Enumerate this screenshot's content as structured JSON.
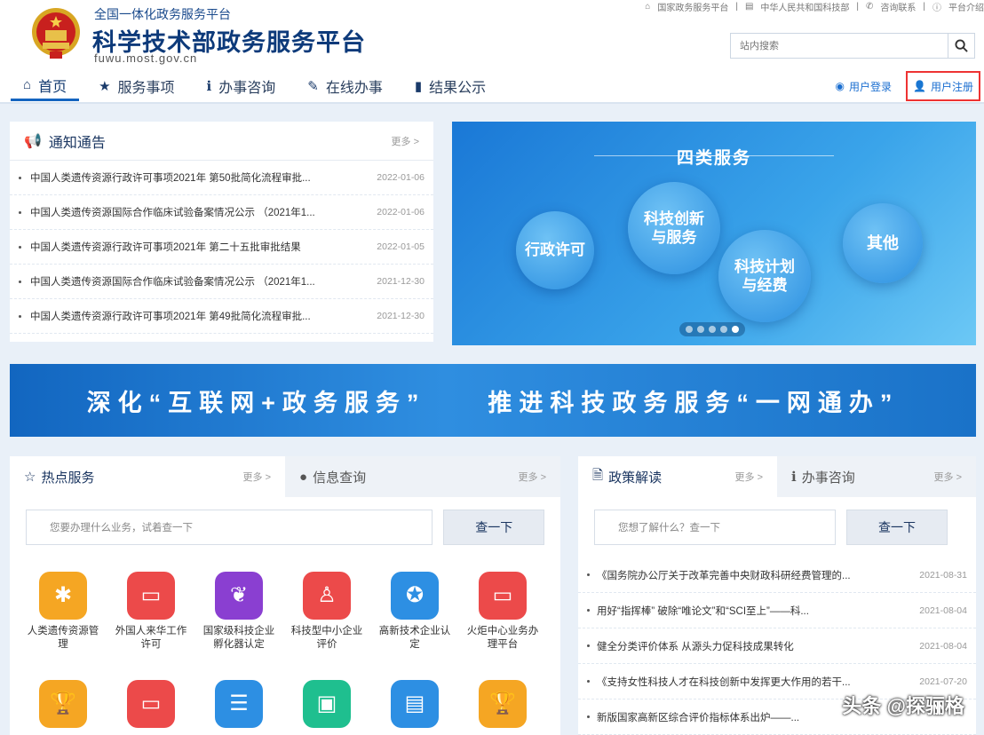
{
  "header": {
    "subtitle": "全国一体化政务服务平台",
    "title": "科学技术部政务服务平台",
    "url": "fuwu.most.gov.cn",
    "top_links": [
      "国家政务服务平台",
      "中华人民共和国科技部",
      "咨询联系",
      "平台介绍"
    ],
    "search_placeholder": "站内搜索"
  },
  "nav": {
    "items": [
      "首页",
      "服务事项",
      "办事咨询",
      "在线办事",
      "结果公示"
    ],
    "login": "用户登录",
    "register": "用户注册"
  },
  "notice": {
    "title": "通知通告",
    "more": "更多 >",
    "items": [
      {
        "text": "中国人类遗传资源行政许可事项2021年 第50批简化流程审批...",
        "date": "2022-01-06"
      },
      {
        "text": "中国人类遗传资源国际合作临床试验备案情况公示 （2021年1...",
        "date": "2022-01-06"
      },
      {
        "text": "中国人类遗传资源行政许可事项2021年 第二十五批审批结果",
        "date": "2022-01-05"
      },
      {
        "text": "中国人类遗传资源国际合作临床试验备案情况公示 （2021年1...",
        "date": "2021-12-30"
      },
      {
        "text": "中国人类遗传资源行政许可事项2021年 第49批简化流程审批...",
        "date": "2021-12-30"
      }
    ]
  },
  "banner": {
    "title": "四类服务",
    "circles": [
      "行政许可",
      "科技创新与服务",
      "科技计划与经费",
      "其他"
    ]
  },
  "slogan": {
    "left": "深化“互联网+政务服务”",
    "right": "推进科技政务服务“一网通办”"
  },
  "hot": {
    "tab1": "热点服务",
    "tab2": "信息查询",
    "more": "更多 >",
    "placeholder": "您要办理什么业务，试着查一下",
    "button": "查一下",
    "services": [
      {
        "label": "人类遗传资源管理",
        "color": "#f5a623",
        "icon": "dna-icon"
      },
      {
        "label": "外国人来华工作许可",
        "color": "#ec4a4a",
        "icon": "monitor-icon"
      },
      {
        "label": "国家级科技企业孵化器认定",
        "color": "#8a3fd1",
        "icon": "hands-icon"
      },
      {
        "label": "科技型中小企业评价",
        "color": "#ec4a4a",
        "icon": "person-shield-icon"
      },
      {
        "label": "高新技术企业认定",
        "color": "#2d8fe3",
        "icon": "badge-icon"
      },
      {
        "label": "火炬中心业务办理平台",
        "color": "#ec4a4a",
        "icon": "monitor-icon"
      },
      {
        "label": "",
        "color": "#f5a623",
        "icon": "trophy-icon"
      },
      {
        "label": "",
        "color": "#ec4a4a",
        "icon": "monitor-icon"
      },
      {
        "label": "",
        "color": "#2d8fe3",
        "icon": "cabinet-icon"
      },
      {
        "label": "",
        "color": "#1fbf8f",
        "icon": "ticket-icon"
      },
      {
        "label": "",
        "color": "#2d8fe3",
        "icon": "document-icon"
      },
      {
        "label": "",
        "color": "#f5a623",
        "icon": "trophy-icon"
      }
    ]
  },
  "policy": {
    "tab1": "政策解读",
    "tab2": "办事咨询",
    "more": "更多 >",
    "placeholder": "您想了解什么？查一下",
    "button": "查一下",
    "items": [
      {
        "text": "《国务院办公厅关于改革完善中央财政科研经费管理的...",
        "date": "2021-08-31"
      },
      {
        "text": "用好“指挥棒” 破除“唯论文”和“SCI至上”——科...",
        "date": "2021-08-04"
      },
      {
        "text": "健全分类评价体系 从源头力促科技成果转化",
        "date": "2021-08-04"
      },
      {
        "text": "《支持女性科技人才在科技创新中发挥更大作用的若干...",
        "date": "2021-07-20"
      },
      {
        "text": "新版国家高新区综合评价指标体系出炉——...",
        "date": ""
      }
    ]
  },
  "watermark": "头条 @探骊格",
  "colors": {
    "brand": "#0d3a7a",
    "accent": "#1565c0",
    "register_highlight": "#e33"
  }
}
